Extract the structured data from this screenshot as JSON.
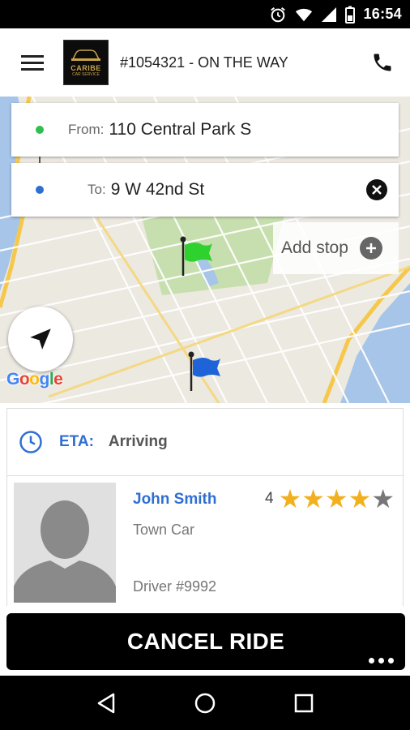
{
  "status_bar": {
    "time": "16:54"
  },
  "app_bar": {
    "title": "#1054321 - ON THE WAY",
    "logo_word": "CARIBE",
    "logo_sub": "CAR SERVICE"
  },
  "route": {
    "from_label": "From:",
    "from_value": "110 Central Park S",
    "to_label": "To:",
    "to_value": "9 W 42nd St",
    "add_stop": "Add stop"
  },
  "map": {
    "google_logo": "Google",
    "pickup_flag_color": "#2fd12f",
    "dropoff_flag_color": "#1e63d8"
  },
  "eta": {
    "label": "ETA:",
    "value": "Arriving"
  },
  "driver": {
    "name": "John Smith",
    "car": "Town Car",
    "id": "Driver #9992",
    "rating": 4,
    "rating_display": "4"
  },
  "actions": {
    "cancel": "CANCEL RIDE"
  },
  "colors": {
    "accent": "#2f6fd1",
    "star": "#f2b01e",
    "star_empty": "#777777"
  }
}
